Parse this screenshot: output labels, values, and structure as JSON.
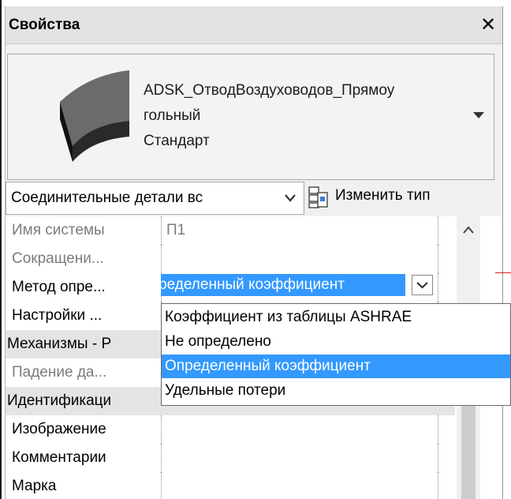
{
  "window": {
    "title": "Свойства",
    "close_glyph": "✕"
  },
  "type_selector": {
    "name_line1": "ADSK_ОтводВоздуховодов_Прямоу",
    "name_line2": "гольный",
    "name_line3": "Стандарт",
    "thumbnail_icon": "duct-elbow-thumbnail",
    "dropdown_icon": "triangle-down-icon"
  },
  "category_filter": {
    "value": "Соединительные детали вс"
  },
  "edit_type": {
    "label": "Изменить тип",
    "icon": "edit-type-icon"
  },
  "properties": {
    "rows": [
      {
        "name": "Имя системы",
        "value": "П1",
        "readonly": true
      },
      {
        "name": "Сокращени...",
        "value": "",
        "readonly": true
      },
      {
        "name": "Метод опре...",
        "value": "",
        "readonly": false
      },
      {
        "name": "Настройки ...",
        "value": "",
        "readonly": false
      }
    ],
    "groups": [
      {
        "name": "Механизмы - Р"
      },
      {
        "name": "Идентификаци"
      }
    ],
    "row_drop": {
      "name": "Падение да...",
      "value": ""
    },
    "identity_rows": [
      {
        "name": "Изображение",
        "value": ""
      },
      {
        "name": "Комментарии",
        "value": ""
      },
      {
        "name": "Марка",
        "value": ""
      }
    ]
  },
  "method_combo": {
    "value": "Определенный коэффициент"
  },
  "method_options": [
    "Коэффициент из таблицы ASHRAE",
    "Не определено",
    "Определенный коэффициент",
    "Удельные потери"
  ],
  "method_selected_index": 2,
  "colors": {
    "selection": "#3399ff",
    "group_row": "#e4e4e4",
    "panel": "#f0f0f0",
    "cursor_line": "#e02020"
  }
}
